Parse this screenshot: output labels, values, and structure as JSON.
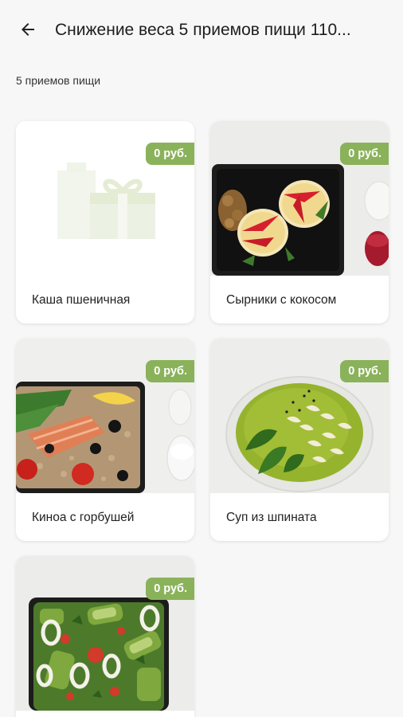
{
  "header": {
    "title": "Снижение веса 5 приемов пищи 110..."
  },
  "subtitle": "5 приемов пищи",
  "colors": {
    "price_badge": "#8ab25a",
    "background": "#f7f7f7"
  },
  "meals": [
    {
      "name": "Каша пшеничная",
      "price": "0 руб.",
      "image": "placeholder-gift-icon"
    },
    {
      "name": "Сырники с кокосом",
      "price": "0 руб.",
      "image": "syrniki-photo"
    },
    {
      "name": "Киноа с горбушей",
      "price": "0 руб.",
      "image": "quinoa-salmon-photo"
    },
    {
      "name": "Суп из шпината",
      "price": "0 руб.",
      "image": "spinach-soup-photo"
    },
    {
      "name": "",
      "price": "0 руб.",
      "image": "squid-avocado-salad-photo"
    }
  ]
}
